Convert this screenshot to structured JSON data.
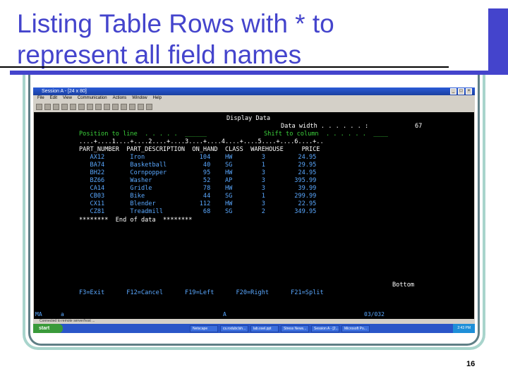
{
  "slide": {
    "title_line1": "Listing Table Rows with * to",
    "title_line2": "represent all field names",
    "page_number": "16"
  },
  "window": {
    "title": "Session A - [24 x 80]",
    "menu": [
      "File",
      "Edit",
      "View",
      "Communication",
      "Actions",
      "Window",
      "Help"
    ]
  },
  "terminal": {
    "header": "Display Data",
    "data_width_label": "Data width . . . . . . :",
    "data_width_value": "67",
    "position_label": "Position to line  . . . . .  ______",
    "shift_label": "Shift to column  . . . . . .  ____",
    "ruler": "....+....1....+....2....+....3....+....4....+....5....+....6....+..",
    "columns": "PART_NUMBER  PART_DESCRIPTION  ON_HAND  CLASS  WAREHOUSE     PRICE",
    "rows": [
      "   AX12       Iron               104    HW        3         24.95",
      "   BA74       Basketball          40    SG        1         29.95",
      "   BH22       Cornpopper          95    HW        3         24.95",
      "   BZ66       Washer              52    AP        3        395.99",
      "   CA14       Gridle              78    HW        3         39.99",
      "   CB03       Bike                44    SG        1        299.99",
      "   CX11       Blender            112    HW        3         22.95",
      "   CZ81       Treadmill           68    SG        2        349.95"
    ],
    "end_line": "********  End of data  ********",
    "bottom_label": "Bottom",
    "function_keys": "F3=Exit      F12=Cancel      F19=Left      F20=Right      F21=Split"
  },
  "status_bar": {
    "left": "MA",
    "sub": "a",
    "mode": "A",
    "position": "03/032"
  },
  "connection_status": "Connected to remote server/host ...",
  "taskbar": {
    "start_label": "start",
    "tasks": [
      "Netscape",
      "cs.rodubclsh...",
      "lab.osel.ppt",
      "Stress News...",
      "Session A - [2...",
      "Microsoft Po..."
    ],
    "clock": "2:43 PM"
  }
}
